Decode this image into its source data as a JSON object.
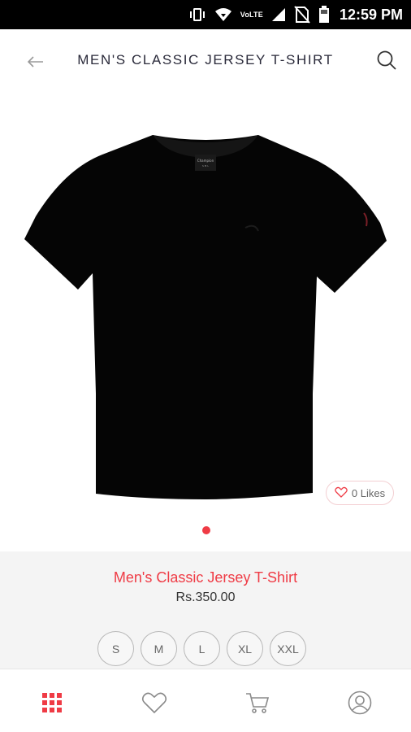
{
  "status_bar": {
    "network_label": "VoLTE",
    "time": "12:59 PM",
    "icons": [
      "vibrate-icon",
      "wifi-icon",
      "signal-icon",
      "no-sim-icon",
      "battery-icon"
    ]
  },
  "header": {
    "title": "MEN'S CLASSIC JERSEY T-SHIRT",
    "icons": [
      "back-arrow-icon",
      "search-icon"
    ]
  },
  "product": {
    "image": "black-t-shirt",
    "likes_label": "0 Likes",
    "name": "Men's Classic Jersey T-Shirt",
    "price": "Rs.350.00",
    "sizes": [
      "S",
      "M",
      "L",
      "XL",
      "XXL"
    ],
    "carousel_pages": 1,
    "carousel_active": 1
  },
  "bottom_nav": {
    "items": [
      "grid-menu-icon",
      "heart-icon",
      "cart-icon",
      "profile-icon"
    ]
  },
  "colors": {
    "accent": "#ef3b45",
    "title_text": "#2a2a3a",
    "info_background": "#f4f4f4"
  }
}
